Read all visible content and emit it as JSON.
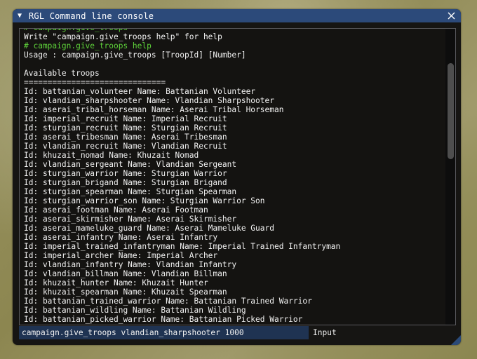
{
  "window": {
    "title": "RGL Command line console",
    "collapse_icon": "▼",
    "close_icon": "close-icon"
  },
  "console": {
    "lines": [
      {
        "text": "# campaign.give_troops",
        "type": "command"
      },
      {
        "text": "Write \"campaign.give_troops help\" for help",
        "type": "output"
      },
      {
        "text": "# campaign.give_troops help",
        "type": "command"
      },
      {
        "text": "Usage : campaign.give_troops [TroopId] [Number]",
        "type": "output"
      },
      {
        "text": "",
        "type": "output"
      },
      {
        "text": "Available troops",
        "type": "output"
      },
      {
        "text": "==============================",
        "type": "output"
      },
      {
        "text": "Id: battanian_volunteer Name: Battanian Volunteer",
        "type": "output"
      },
      {
        "text": "Id: vlandian_sharpshooter Name: Vlandian Sharpshooter",
        "type": "output"
      },
      {
        "text": "Id: aserai_tribal_horseman Name: Aserai Tribal Horseman",
        "type": "output"
      },
      {
        "text": "Id: imperial_recruit Name: Imperial Recruit",
        "type": "output"
      },
      {
        "text": "Id: sturgian_recruit Name: Sturgian Recruit",
        "type": "output"
      },
      {
        "text": "Id: aserai_tribesman Name: Aserai Tribesman",
        "type": "output"
      },
      {
        "text": "Id: vlandian_recruit Name: Vlandian Recruit",
        "type": "output"
      },
      {
        "text": "Id: khuzait_nomad Name: Khuzait Nomad",
        "type": "output"
      },
      {
        "text": "Id: vlandian_sergeant Name: Vlandian Sergeant",
        "type": "output"
      },
      {
        "text": "Id: sturgian_warrior Name: Sturgian Warrior",
        "type": "output"
      },
      {
        "text": "Id: sturgian_brigand Name: Sturgian Brigand",
        "type": "output"
      },
      {
        "text": "Id: sturgian_spearman Name: Sturgian Spearman",
        "type": "output"
      },
      {
        "text": "Id: sturgian_warrior_son Name: Sturgian Warrior Son",
        "type": "output"
      },
      {
        "text": "Id: aserai_footman Name: Aserai Footman",
        "type": "output"
      },
      {
        "text": "Id: aserai_skirmisher Name: Aserai Skirmisher",
        "type": "output"
      },
      {
        "text": "Id: aserai_mameluke_guard Name: Aserai Mameluke Guard",
        "type": "output"
      },
      {
        "text": "Id: aserai_infantry Name: Aserai Infantry",
        "type": "output"
      },
      {
        "text": "Id: imperial_trained_infantryman Name: Imperial Trained Infantryman",
        "type": "output"
      },
      {
        "text": "Id: imperial_archer Name: Imperial Archer",
        "type": "output"
      },
      {
        "text": "Id: vlandian_infantry Name: Vlandian Infantry",
        "type": "output"
      },
      {
        "text": "Id: vlandian_billman Name: Vlandian Billman",
        "type": "output"
      },
      {
        "text": "Id: khuzait_hunter Name: Khuzait Hunter",
        "type": "output"
      },
      {
        "text": "Id: khuzait_spearman Name: Khuzait Spearman",
        "type": "output"
      },
      {
        "text": "Id: battanian_trained_warrior Name: Battanian Trained Warrior",
        "type": "output"
      },
      {
        "text": "Id: battanian_wildling Name: Battanian Wildling",
        "type": "output"
      },
      {
        "text": "Id: battanian_picked_warrior Name: Battanian Picked Warrior",
        "type": "output"
      }
    ]
  },
  "input": {
    "value": "campaign.give_troops vlandian_sharpshooter 1000",
    "label": "Input"
  },
  "colors": {
    "titlebar": "#2c4a7a",
    "command_text": "#5ed23a",
    "output_text": "#f2f2f2",
    "input_bg": "#1f3352"
  }
}
